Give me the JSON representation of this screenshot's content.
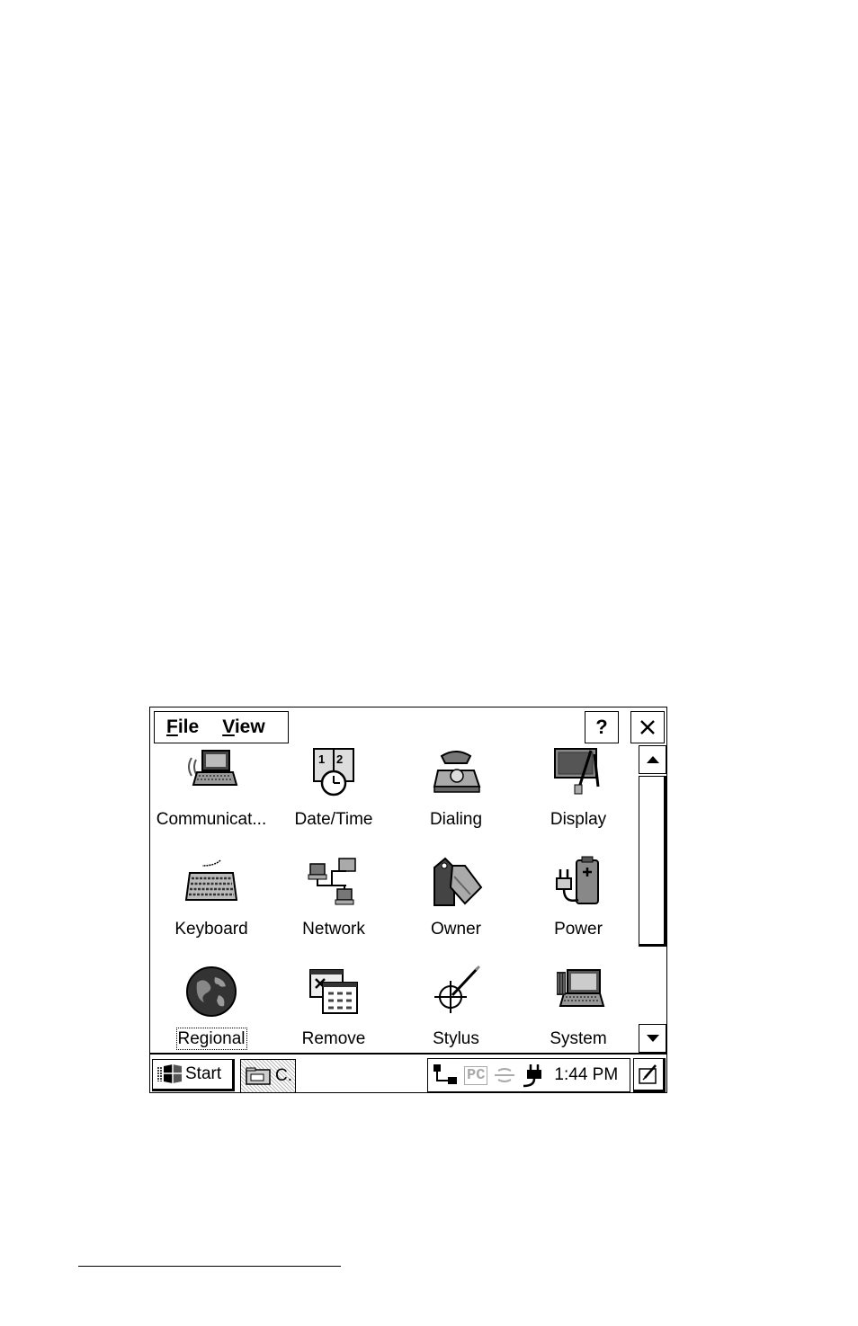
{
  "menu": {
    "file_label": "File",
    "file_hotkey": "F",
    "file_rest": "ile",
    "view_label": "View",
    "view_hotkey": "V",
    "view_rest": "iew"
  },
  "titlebar": {
    "help_label": "?",
    "close_label": "✕"
  },
  "items": [
    {
      "label": "Communicat...",
      "icon": "communication-icon"
    },
    {
      "label": "Date/Time",
      "icon": "date-time-icon"
    },
    {
      "label": "Dialing",
      "icon": "telephone-icon"
    },
    {
      "label": "Display",
      "icon": "display-icon"
    },
    {
      "label": "Keyboard",
      "icon": "keyboard-icon"
    },
    {
      "label": "Network",
      "icon": "network-icon"
    },
    {
      "label": "Owner",
      "icon": "owner-tag-icon"
    },
    {
      "label": "Power",
      "icon": "power-icon"
    },
    {
      "label": "Regional",
      "icon": "globe-icon"
    },
    {
      "label": "Remove",
      "icon": "remove-programs-icon"
    },
    {
      "label": "Stylus",
      "icon": "stylus-icon"
    },
    {
      "label": "System",
      "icon": "system-icon"
    }
  ],
  "taskbar": {
    "start_label": "Start",
    "task_label": "C.",
    "tray_pc": "PC",
    "clock": "1:44 PM"
  }
}
